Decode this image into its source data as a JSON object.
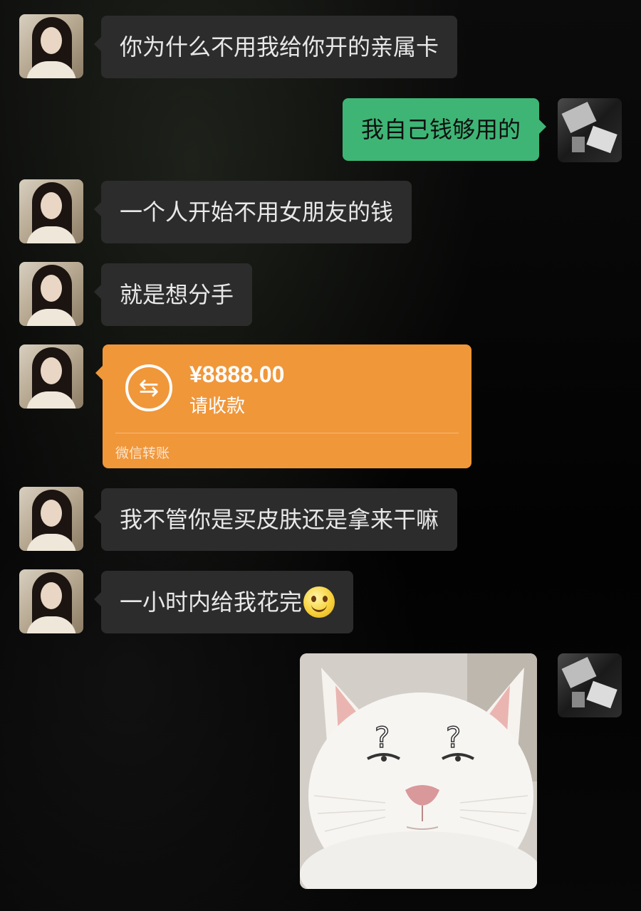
{
  "messages": [
    {
      "side": "left",
      "text": "你为什么不用我给你开的亲属卡"
    },
    {
      "side": "right",
      "text": "我自己钱够用的"
    },
    {
      "side": "left",
      "text": "一个人开始不用女朋友的钱"
    },
    {
      "side": "left",
      "text": "就是想分手"
    },
    {
      "side": "left",
      "type": "transfer"
    },
    {
      "side": "left",
      "text": "我不管你是买皮肤还是拿来干嘛"
    },
    {
      "side": "left",
      "text": "一小时内给我花完",
      "emoji": "smile-emoji"
    },
    {
      "side": "right",
      "type": "image",
      "image": "white-cat-question-marks"
    }
  ],
  "transfer": {
    "amount": "¥8888.00",
    "note": "请收款",
    "footer": "微信转账",
    "icon": "transfer-arrows-icon"
  },
  "sticker_text": {
    "q1": "?",
    "q2": "?"
  },
  "colors": {
    "incoming_bubble": "#2c2c2c",
    "outgoing_bubble": "#3eb575",
    "transfer": "#f0973a",
    "background": "#050505"
  }
}
